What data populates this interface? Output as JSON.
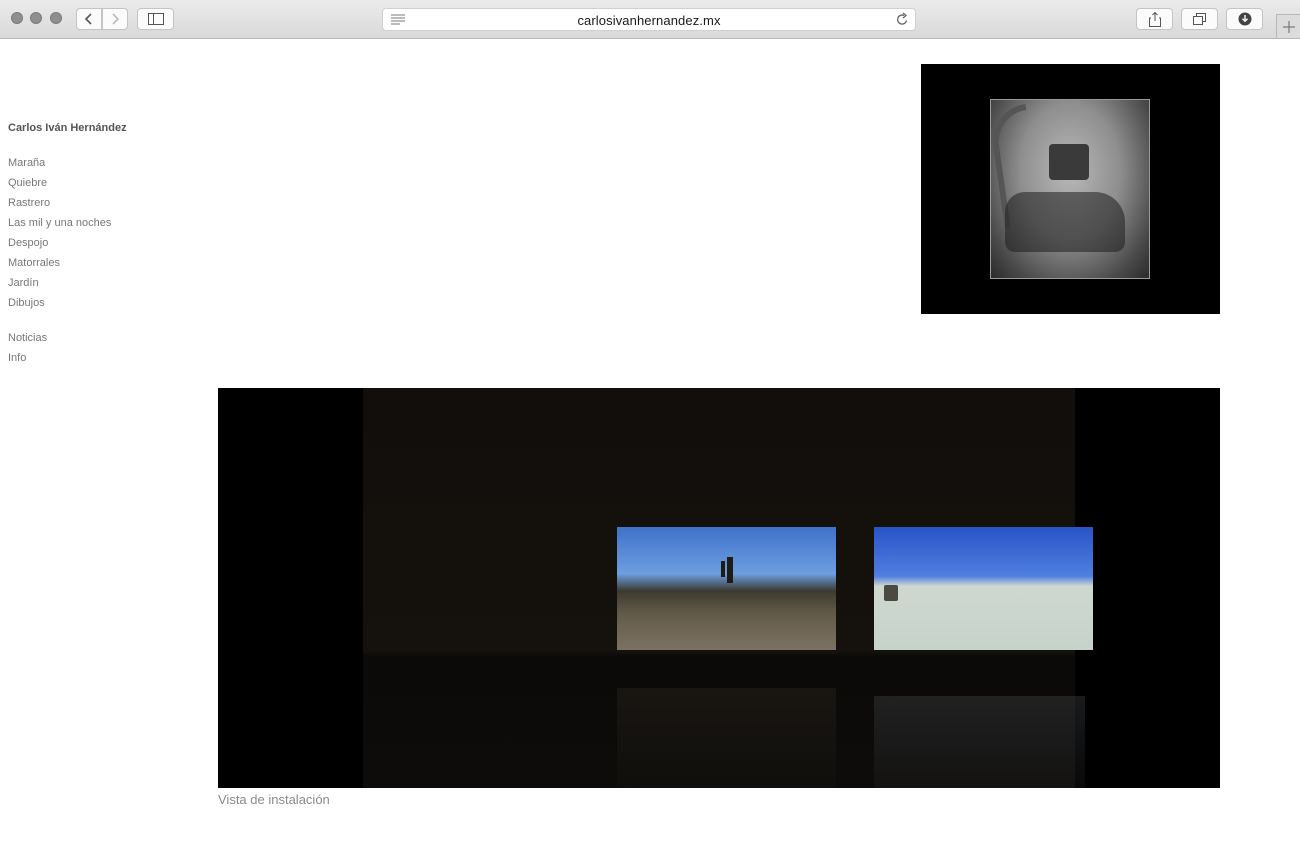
{
  "browser": {
    "url": "carlosivanhernandez.mx"
  },
  "site": {
    "title": "Carlos Iván Hernández"
  },
  "nav": {
    "works": [
      {
        "label": "Maraña"
      },
      {
        "label": "Quiebre"
      },
      {
        "label": "Rastrero"
      },
      {
        "label": "Las mil y una noches"
      },
      {
        "label": "Despojo"
      },
      {
        "label": "Matorrales"
      },
      {
        "label": "Jardín"
      },
      {
        "label": "Dibujos"
      }
    ],
    "other": [
      {
        "label": "Noticias"
      },
      {
        "label": "Info"
      }
    ]
  },
  "media": {
    "caption": "Vista de instalación"
  }
}
